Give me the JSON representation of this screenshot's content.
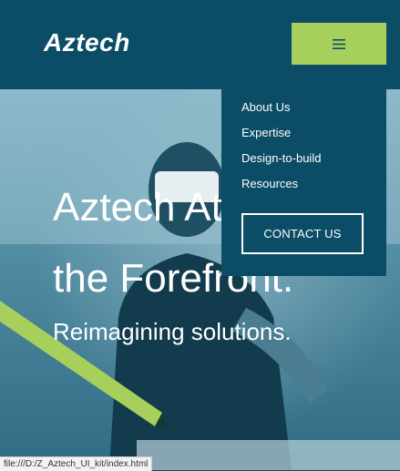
{
  "header": {
    "logo": "Aztech",
    "menu_button_label": "≡"
  },
  "hero": {
    "title_line1": "Aztech At",
    "title_line2": "the Forefront.",
    "subtitle": "Reimagining solutions."
  },
  "dropdown": {
    "items": [
      {
        "label": "About Us"
      },
      {
        "label": "Expertise"
      },
      {
        "label": "Design-to-build"
      },
      {
        "label": "Resources"
      }
    ],
    "contact_label": "CONTACT US"
  },
  "statusbar": {
    "url": "file:///D:/Z_Aztech_UI_kit/index.html"
  },
  "colors": {
    "header_bg": "#0b4c66",
    "accent_green": "#a6cf5c",
    "text_white": "#ffffff"
  }
}
